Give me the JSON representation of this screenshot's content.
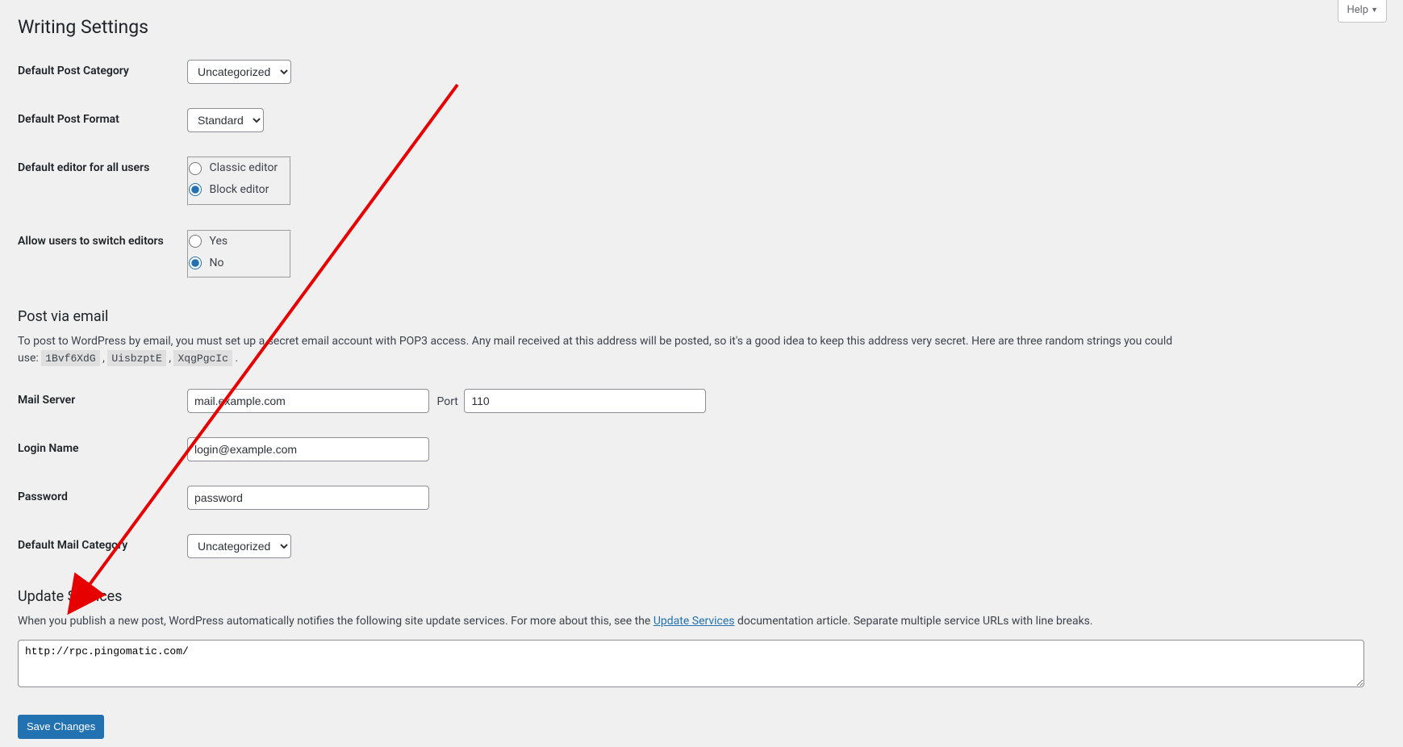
{
  "help_tab": {
    "label": "Help"
  },
  "page_title": "Writing Settings",
  "default_post_category": {
    "label": "Default Post Category",
    "value": "Uncategorized"
  },
  "default_post_format": {
    "label": "Default Post Format",
    "value": "Standard"
  },
  "default_editor": {
    "label": "Default editor for all users",
    "option_classic": "Classic editor",
    "option_block": "Block editor"
  },
  "allow_switch": {
    "label": "Allow users to switch editors",
    "option_yes": "Yes",
    "option_no": "No"
  },
  "post_via_email": {
    "heading": "Post via email",
    "desc_pre": "To post to WordPress by email, you must set up a secret email account with POP3 access. Any mail received at this address will be posted, so it's a good idea to keep this address very secret. Here are three random strings you could use: ",
    "random1": "1Bvf6XdG",
    "random2": "UisbzptE",
    "random3": "XqgPgcIc"
  },
  "mail_server": {
    "label": "Mail Server",
    "value": "mail.example.com",
    "port_label": "Port",
    "port_value": "110"
  },
  "login_name": {
    "label": "Login Name",
    "value": "login@example.com"
  },
  "password": {
    "label": "Password",
    "value": "password"
  },
  "default_mail_category": {
    "label": "Default Mail Category",
    "value": "Uncategorized"
  },
  "update_services": {
    "heading": "Update Services",
    "desc_pre": "When you publish a new post, WordPress automatically notifies the following site update services. For more about this, see the ",
    "link_text": "Update Services",
    "desc_post": " documentation article. Separate multiple service URLs with line breaks.",
    "textarea_value": "http://rpc.pingomatic.com/"
  },
  "submit": {
    "label": "Save Changes"
  }
}
